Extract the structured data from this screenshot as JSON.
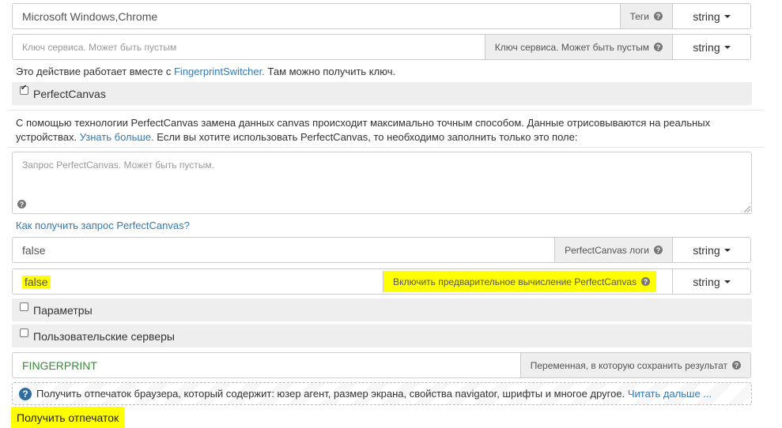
{
  "rows": {
    "tags": {
      "value": "Microsoft Windows,Chrome",
      "label": "Теги",
      "type": "string"
    },
    "service_key": {
      "placeholder": "Ключ сервиса. Может быть пустым",
      "label": "Ключ сервиса. Может быть пустым",
      "type": "string"
    },
    "pc_logs": {
      "value": "false",
      "label": "PerfectCanvas логи",
      "type": "string"
    },
    "pc_precompute": {
      "value": "false",
      "label": "Включить предварительное вычисление PerfectCanvas",
      "type": "string"
    },
    "result_var": {
      "value": "FINGERPRINT",
      "label": "Переменная, в которую сохранить результат"
    }
  },
  "switcher_note": {
    "before": "Это действие работает вместе с ",
    "link": "FingerprintSwitcher.",
    "after": " Там можно получить ключ."
  },
  "perfectcanvas_checkbox": {
    "label": "PerfectCanvas",
    "checked": true
  },
  "pc_description": {
    "line1": "С помощью технологии PerfectCanvas замена данных canvas происходит максимально точным способом. Данные отрисовываются на реальных",
    "line2_before": "устройствах. ",
    "line2_link": "Узнать больше.",
    "line2_after": " Если вы хотите использовать PerfectCanvas, то необходимо заполнить только это поле:"
  },
  "pc_request": {
    "placeholder": "Запрос PerfectCanvas. Может быть пустым."
  },
  "pc_request_help_link": "Как получить запрос PerfectCanvas?",
  "params_checkbox": {
    "label": "Параметры",
    "checked": false
  },
  "custom_servers_checkbox": {
    "label": "Пользовательские серверы",
    "checked": false
  },
  "info": {
    "text": "Получить отпечаток браузера, который содержит: юзер агент, размер экрана, свойства navigator, шрифты и многое другое. ",
    "link": "Читать дальше ..."
  },
  "submit_label": "Получить отпечаток",
  "colors": {
    "link": "#337ab7",
    "highlight": "#ffff00",
    "result_text": "#3c8a3c"
  },
  "icons": [
    "question-icon",
    "info-icon",
    "caret-down-icon",
    "checkbox-icon",
    "resize-grip-icon"
  ]
}
